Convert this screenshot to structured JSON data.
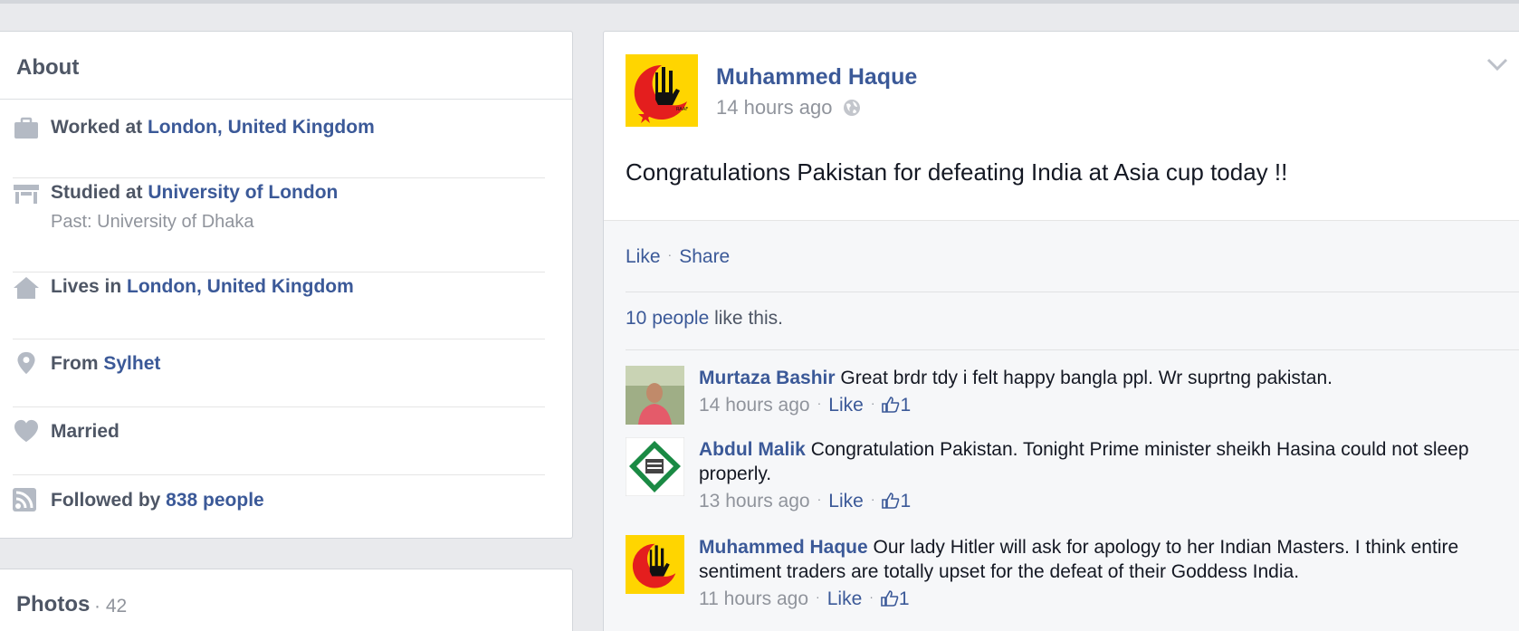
{
  "about": {
    "title": "About",
    "work": {
      "prefix": "Worked at ",
      "place": "London, United Kingdom",
      "icon": "briefcase-icon"
    },
    "study": {
      "prefix": "Studied at ",
      "place": "University of London",
      "past": "Past: University of Dhaka",
      "icon": "school-icon"
    },
    "lives": {
      "prefix": "Lives in ",
      "place": "London, United Kingdom",
      "icon": "house-icon"
    },
    "from": {
      "prefix": "From ",
      "place": "Sylhet",
      "icon": "location-pin-icon"
    },
    "relationship": {
      "text": "Married",
      "icon": "heart-icon"
    },
    "followers": {
      "prefix": "Followed by ",
      "count": "838 people",
      "icon": "rss-icon"
    }
  },
  "photos": {
    "title": "Photos",
    "count": "· 42"
  },
  "post": {
    "author": "Muhammed Haque",
    "time": "14 hours ago",
    "text": "Congratulations Pakistan for defeating India at Asia cup today !!",
    "actions": {
      "like": "Like",
      "share": "Share"
    },
    "likes": {
      "count": "10 people",
      "suffix": " like this."
    },
    "comments": [
      {
        "author": "Murtaza Bashir",
        "text": "Great brdr tdy i felt happy bangla ppl. Wr suprtng pakistan.",
        "time": "14 hours ago",
        "like": "Like",
        "likes": "1"
      },
      {
        "author": "Abdul Malik",
        "text": "Congratulation Pakistan. Tonight Prime minister sheikh Hasina could not sleep properly.",
        "time": "13 hours ago",
        "like": "Like",
        "likes": "1"
      },
      {
        "author": "Muhammed Haque",
        "text": "Our lady Hitler will ask for apology to her Indian Masters. I think entire sentiment traders are totally upset for the defeat of their Goddess India.",
        "time": "11 hours ago",
        "like": "Like",
        "likes": "1"
      }
    ]
  },
  "colors": {
    "link": "#3b5998",
    "muted": "#90949c",
    "text": "#4e5665",
    "background": "#e9eaed"
  }
}
